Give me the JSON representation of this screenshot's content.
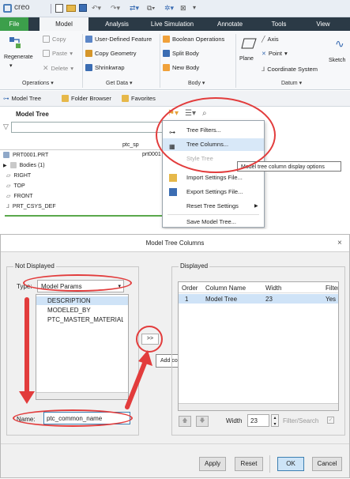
{
  "app": {
    "brand": "creo",
    "tabs": [
      "File",
      "Model",
      "Analysis",
      "Live Simulation",
      "Annotate",
      "Tools",
      "View"
    ]
  },
  "ribbon": {
    "regenerate": "Regenerate",
    "copy": "Copy",
    "paste": "Paste",
    "delete": "Delete",
    "user_defined_feature": "User-Defined Feature",
    "copy_geometry": "Copy Geometry",
    "shrinkwrap": "Shrinkwrap",
    "boolean_operations": "Boolean Operations",
    "split_body": "Split Body",
    "new_body": "New Body",
    "plane": "Plane",
    "axis": "Axis",
    "point": "Point",
    "coordinate_system": "Coordinate System",
    "sketch": "Sketch",
    "groups": [
      "Operations",
      "Get Data",
      "Body",
      "Datum"
    ]
  },
  "tree_toolbar": {
    "model_tree": "Model Tree",
    "folder_browser": "Folder Browser",
    "favorites": "Favorites"
  },
  "tree": {
    "header": "Model Tree",
    "col_header_1": "ptc_sp",
    "root": "PRT0001.PRT",
    "root_value": "prt0001",
    "items": [
      "Bodies (1)",
      "RIGHT",
      "TOP",
      "FRONT",
      "PRT_CSYS_DEF"
    ]
  },
  "menu": {
    "items": [
      "Tree Filters...",
      "Tree Columns...",
      "Style Tree",
      "Import Settings File...",
      "Export Settings File...",
      "Reset Tree Settings",
      "Save Model Tree..."
    ]
  },
  "tooltip": "Model tree column display options",
  "dialog": {
    "title": "Model Tree Columns",
    "not_displayed": "Not Displayed",
    "type_label": "Type:",
    "type_value": "Model Params",
    "available": [
      "DESCRIPTION",
      "MODELED_BY",
      "PTC_MASTER_MATERIAL"
    ],
    "add_button": ">>",
    "add_tooltip": "Add column",
    "name_label": "Name:",
    "name_value": "ptc_common_name",
    "displayed": "Displayed",
    "columns": [
      "Order",
      "Column Name",
      "Width",
      "Filter"
    ],
    "rows": [
      {
        "order": "1",
        "name": "Model Tree",
        "width": "23",
        "filter": "Yes"
      }
    ],
    "width_label": "Width",
    "width_value": "23",
    "filter_search": "Filter/Search",
    "buttons": {
      "apply": "Apply",
      "reset": "Reset",
      "ok": "OK",
      "cancel": "Cancel"
    }
  },
  "colors": {
    "accent": "#2e6fbd",
    "annotation": "#e23c3c",
    "file_tab": "#3c9f4b"
  }
}
